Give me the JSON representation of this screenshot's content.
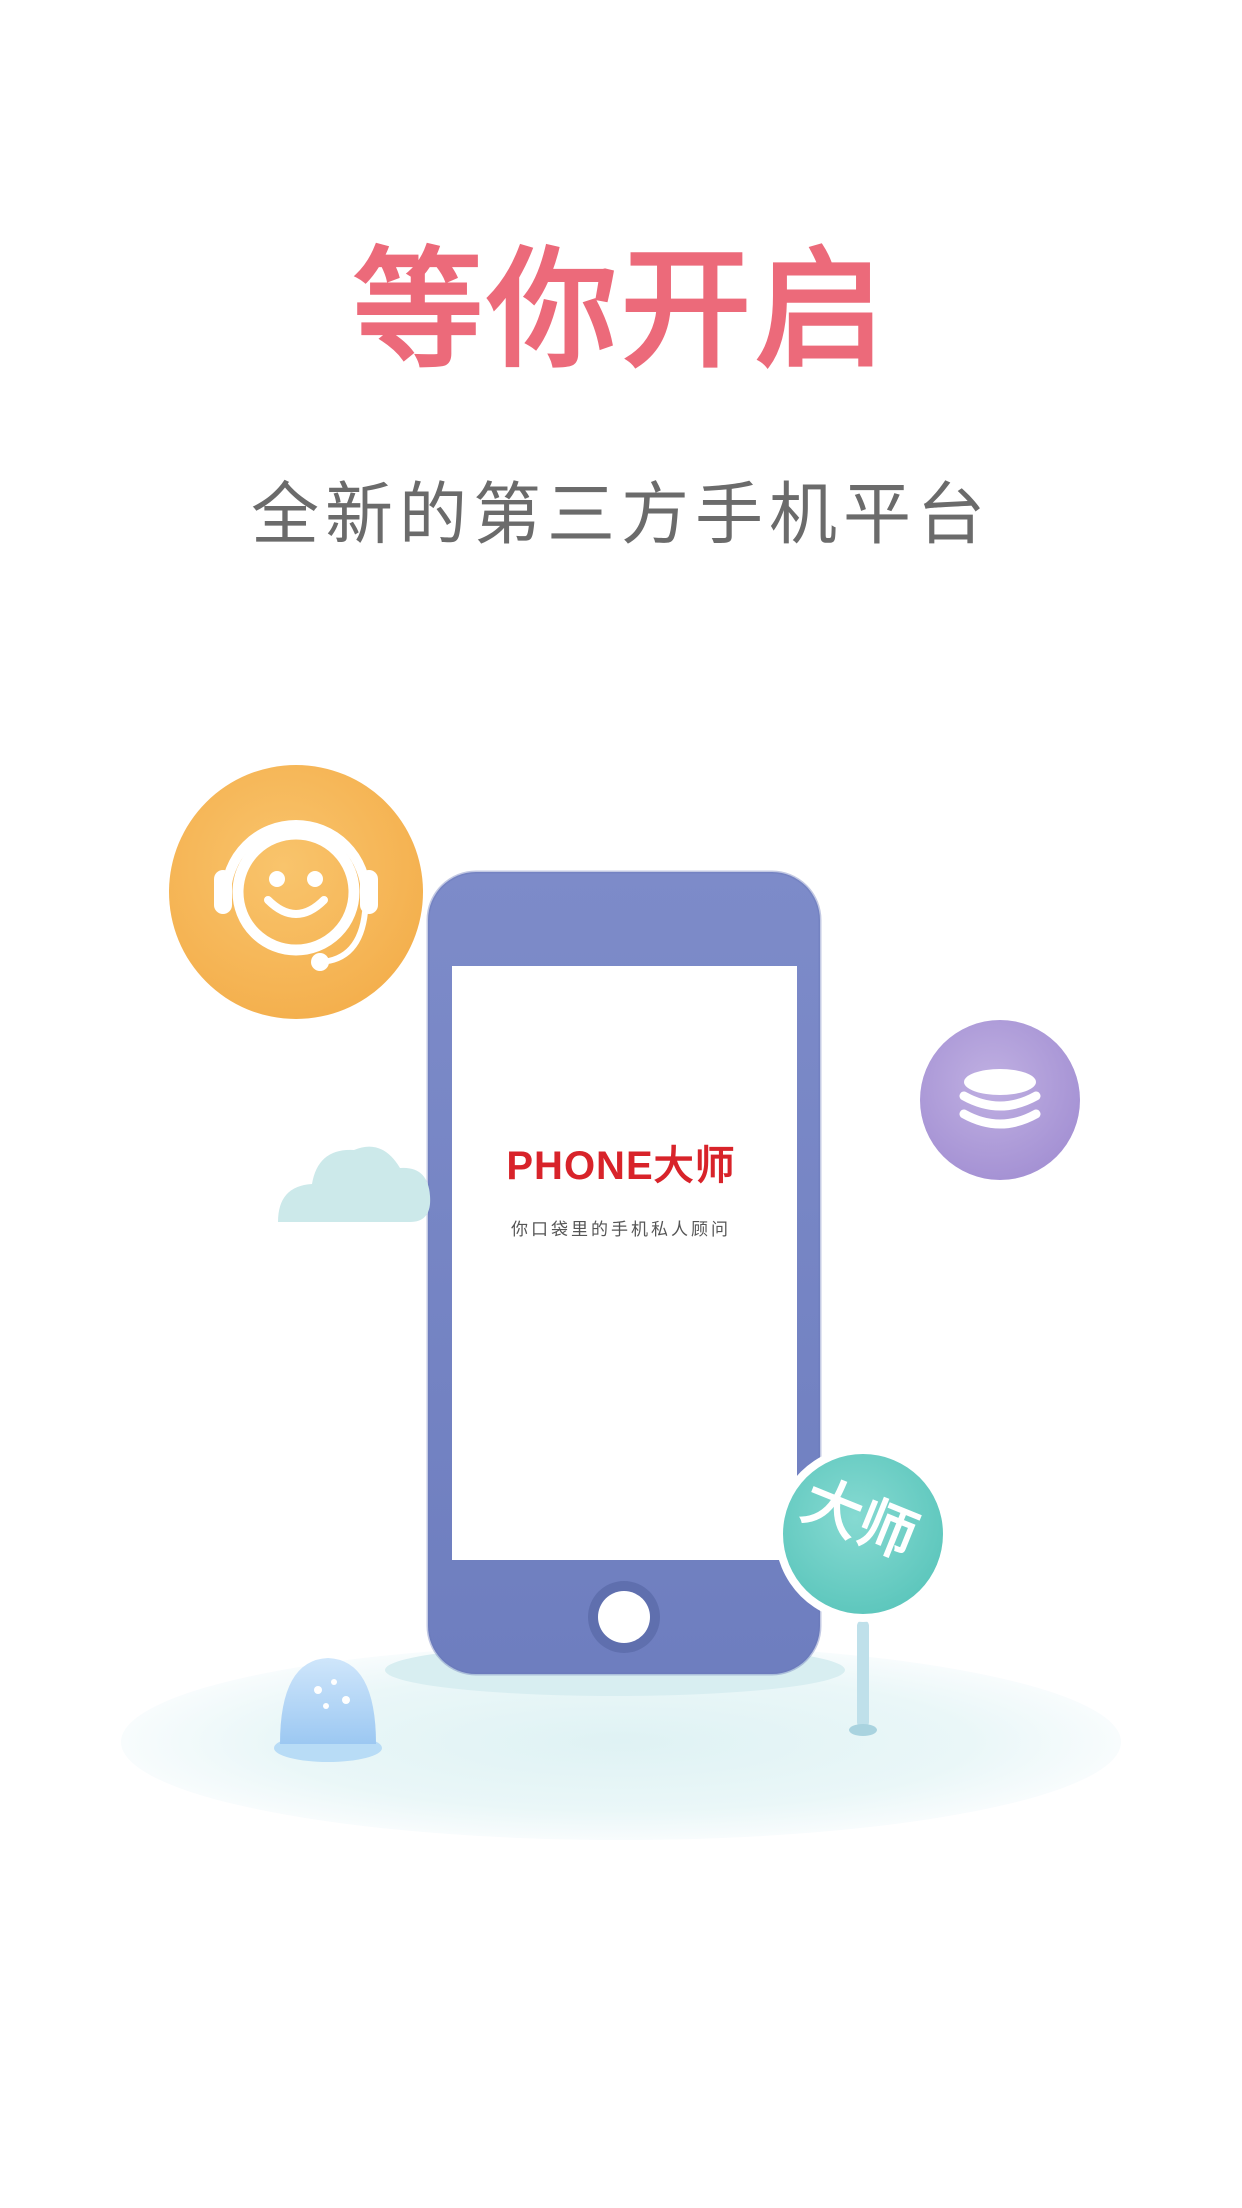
{
  "splash": {
    "title": "等你开启",
    "subtitle": "全新的第三方手机平台"
  },
  "phone_screen": {
    "brand": "PHONE大师",
    "tagline": "你口袋里的手机私人顾问"
  },
  "badge": {
    "label": "大师"
  },
  "icons": {
    "support": "customer-service-smiley-icon",
    "stack": "database-stack-icon",
    "cloud": "cloud-icon",
    "bell": "jelly-bell-icon"
  },
  "colors": {
    "title": "#ec6a7a",
    "subtitle": "#6b6b6b",
    "phone_body": "#7887c4",
    "support_circle": "#f7bd5f",
    "stack_circle": "#b3a1d9",
    "badge_circle": "#6fcfc6",
    "cloud": "#bfe6e6",
    "ground": "#e9f6f8",
    "brand": "#d8232a"
  }
}
